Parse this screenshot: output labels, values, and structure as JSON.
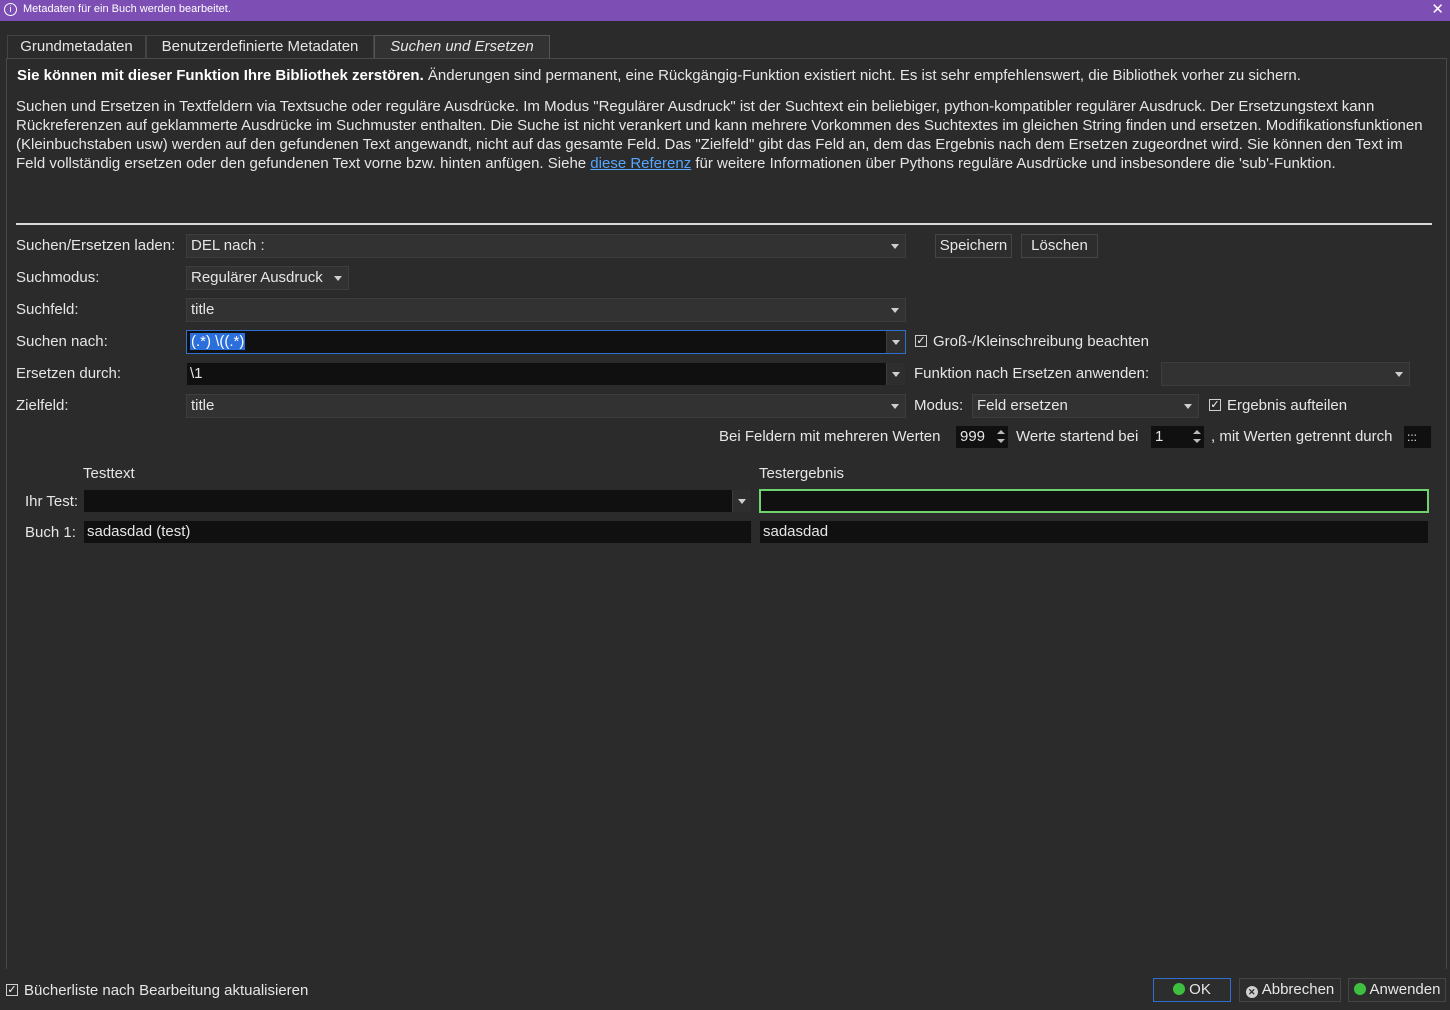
{
  "titlebar": {
    "info_icon": "i",
    "text": "Metadaten für ein Buch werden bearbeitet.",
    "close_icon": "✕"
  },
  "tabs": [
    {
      "label": "Grundmetadaten"
    },
    {
      "label": "Benutzerdefinierte Metadaten"
    },
    {
      "label": "Suchen und Ersetzen"
    }
  ],
  "warning": {
    "bold": "Sie können mit dieser Funktion Ihre Bibliothek zerstören.",
    "rest": " Änderungen sind permanent, eine Rückgängig-Funktion existiert nicht. Es ist sehr empfehlenswert, die Bibliothek vorher zu sichern."
  },
  "description": {
    "text_before_link": "Suchen und Ersetzen in Textfeldern via Textsuche oder reguläre Ausdrücke. Im Modus \"Regulärer Ausdruck\" ist der Suchtext ein beliebiger, python-kompatibler regulärer Ausdruck. Der Ersetzungstext kann Rückreferenzen auf geklammerte Ausdrücke im Suchmuster enthalten. Die Suche ist nicht verankert und kann mehrere Vorkommen des Suchtextes im gleichen String finden und ersetzen. Modifikationsfunktionen (Kleinbuchstaben usw) werden auf den gefundenen Text angewandt, nicht auf das gesamte Feld. Das \"Zielfeld\" gibt das Feld an, dem das Ergebnis nach dem Ersetzen zugeordnet wird. Sie können den Text im Feld vollständig ersetzen oder den gefundenen Text vorne bzw. hinten anfügen. Siehe ",
    "link": "diese Referenz",
    "text_after_link": " für weitere Informationen über Pythons reguläre Ausdrücke und insbesondere die 'sub'-Funktion."
  },
  "form": {
    "load_label": "Suchen/Ersetzen laden:",
    "load_value": "DEL nach :",
    "save_button": "Speichern",
    "delete_button": "Löschen",
    "mode_label": "Suchmodus:",
    "mode_value": "Regulärer Ausdruck",
    "field_label": "Suchfeld:",
    "field_value": "title",
    "search_label": "Suchen nach:",
    "search_value": "(.*) \\((.*)",
    "case_label": "Groß-/Kleinschreibung beachten",
    "replace_label": "Ersetzen durch:",
    "replace_value": "\\1",
    "func_label": "Funktion nach Ersetzen anwenden:",
    "func_value": "",
    "dest_label": "Zielfeld:",
    "dest_value": "title",
    "modus_label": "Modus:",
    "modus_value": "Feld ersetzen",
    "split_label": "Ergebnis aufteilen",
    "multi_label": "Bei Feldern mit mehreren Werten",
    "multi_value": "999",
    "start_label": "Werte startend bei",
    "start_value": "1",
    "sep_label": ", mit Werten getrennt durch",
    "sep_value": ":::"
  },
  "test": {
    "col_text": "Testtext",
    "col_result": "Testergebnis",
    "your_test_label": "Ihr Test:",
    "your_test_value": "",
    "your_test_result": "",
    "book1_label": "Buch 1:",
    "book1_value": "sadasdad (test)",
    "book1_result": "sadasdad"
  },
  "footer": {
    "refresh_label": "Bücherliste nach Bearbeitung aktualisieren",
    "ok": "OK",
    "cancel": "Abbrechen",
    "apply": "Anwenden"
  },
  "colors": {
    "titlebar": "#7d4fb5",
    "link": "#56a7ff",
    "focus": "#2f6fd0",
    "result_border": "#6ed36e"
  }
}
